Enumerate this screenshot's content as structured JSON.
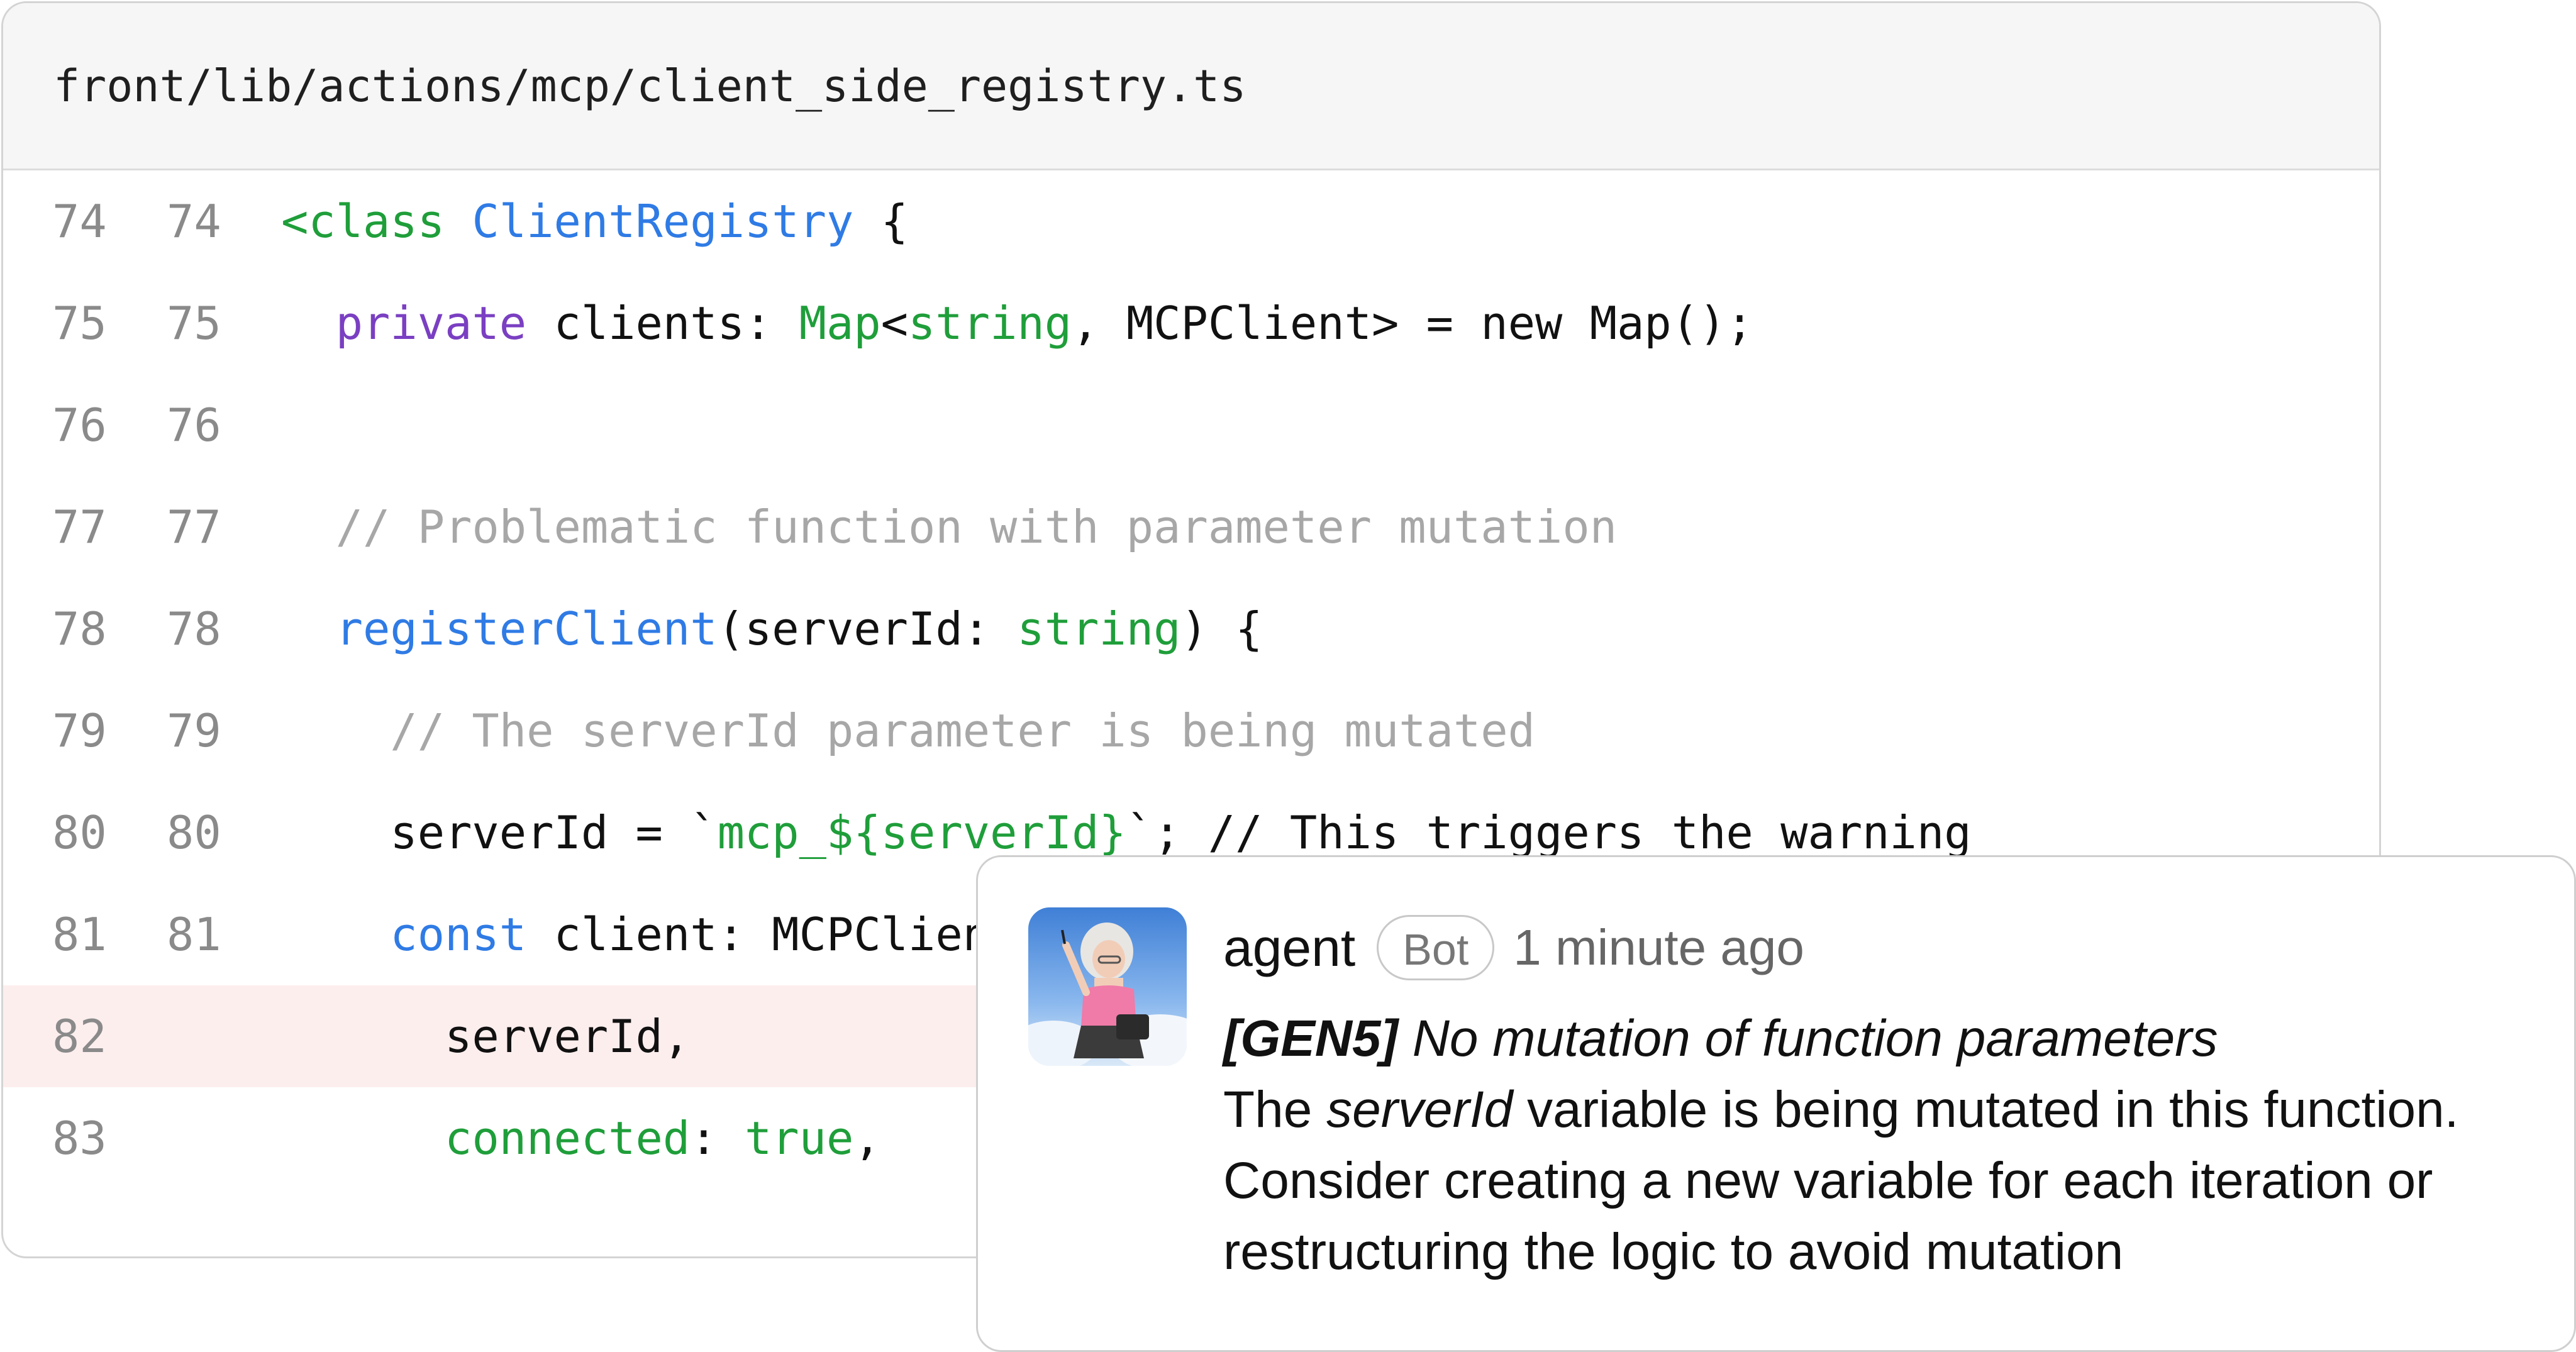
{
  "file": {
    "path": "front/lib/actions/mcp/client_side_registry.ts"
  },
  "lines": [
    {
      "old": "74",
      "new": "74",
      "tokens": [
        {
          "t": "<class ",
          "c": "green"
        },
        {
          "t": "ClientRegistry",
          "c": "blue"
        },
        {
          "t": " {",
          "c": "plain"
        }
      ]
    },
    {
      "old": "75",
      "new": "75",
      "tokens": [
        {
          "t": "  ",
          "c": "plain"
        },
        {
          "t": "private",
          "c": "purple"
        },
        {
          "t": " clients: ",
          "c": "plain"
        },
        {
          "t": "Map",
          "c": "green"
        },
        {
          "t": "<",
          "c": "plain"
        },
        {
          "t": "string",
          "c": "green"
        },
        {
          "t": ", MCPClient> = new Map();",
          "c": "plain"
        }
      ]
    },
    {
      "old": "76",
      "new": "76",
      "tokens": []
    },
    {
      "old": "77",
      "new": "77",
      "tokens": [
        {
          "t": "  ",
          "c": "plain"
        },
        {
          "t": "// Problematic function with parameter mutation",
          "c": "comment"
        }
      ]
    },
    {
      "old": "78",
      "new": "78",
      "tokens": [
        {
          "t": "  ",
          "c": "plain"
        },
        {
          "t": "registerClient",
          "c": "blue"
        },
        {
          "t": "(serverId: ",
          "c": "plain"
        },
        {
          "t": "string",
          "c": "green"
        },
        {
          "t": ") {",
          "c": "plain"
        }
      ]
    },
    {
      "old": "79",
      "new": "79",
      "tokens": [
        {
          "t": "    ",
          "c": "plain"
        },
        {
          "t": "// The serverId parameter is being mutated",
          "c": "comment"
        }
      ]
    },
    {
      "old": "80",
      "new": "80",
      "tokens": [
        {
          "t": "    serverId = `",
          "c": "plain"
        },
        {
          "t": "mcp_${serverId}",
          "c": "green"
        },
        {
          "t": "`; // This triggers the warning",
          "c": "plain"
        }
      ]
    },
    {
      "old": "81",
      "new": "81",
      "tokens": [
        {
          "t": "    ",
          "c": "plain"
        },
        {
          "t": "const",
          "c": "blue"
        },
        {
          "t": " client: MCPClient = {",
          "c": "plain"
        }
      ]
    },
    {
      "old": "82",
      "new": "",
      "removed": true,
      "tokens": [
        {
          "t": "      serverId,",
          "c": "plain"
        }
      ]
    },
    {
      "old": "83",
      "new": "",
      "tokens": [
        {
          "t": "      ",
          "c": "plain"
        },
        {
          "t": "connected",
          "c": "green"
        },
        {
          "t": ": ",
          "c": "plain"
        },
        {
          "t": "true",
          "c": "green"
        },
        {
          "t": ",",
          "c": "plain"
        }
      ]
    }
  ],
  "comment": {
    "author": "agent",
    "badge": "Bot",
    "time": "1 minute ago",
    "rule_code": "[GEN5]",
    "rule_title": " No mutation of function parameters",
    "body_pre": "The ",
    "body_var": "serverId",
    "body_line1_rest": " variable is being mutated in this function.",
    "body_line2": "Consider creating a new variable for each iteration or",
    "body_line3": "restructuring the logic to avoid mutation"
  },
  "colors": {
    "green": "#1f9e3a",
    "blue": "#2f7be5",
    "purple": "#7a3fc2",
    "comment": "#a7a7a7",
    "removed_bg": "#fdeeee"
  }
}
